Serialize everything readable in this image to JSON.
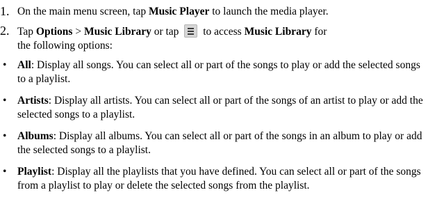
{
  "steps": [
    {
      "number": "1.",
      "t1": "On the main menu screen, tap ",
      "b1": "Music Player",
      "t2": " to launch the media player."
    },
    {
      "number": "2.",
      "t1": "Tap ",
      "b1": "Options",
      "t2": " > ",
      "b2": "Music Library",
      "t3": " or tap ",
      "icon": "menu-list-icon",
      "t4": " to access ",
      "b3": "Music Library",
      "t5": " for",
      "t6": "the following options:"
    }
  ],
  "bullets": [
    {
      "marker": "•",
      "term": "All",
      "text": ": Display all songs. You can select all or part of the songs to play or add the selected songs to a playlist."
    },
    {
      "marker": "•",
      "term": "Artists",
      "text": ": Display all artists. You can select all or part of the songs of an artist to play or add the selected songs to a playlist."
    },
    {
      "marker": "•",
      "term": "Albums",
      "text": ": Display all albums. You can select all or part of the songs in an album to play or add the selected songs to a playlist."
    },
    {
      "marker": "•",
      "term": "Playlist",
      "text": ": Display all the playlists that you have defined. You can select all or part of the songs from a playlist to play or delete the selected songs from the playlist."
    }
  ]
}
